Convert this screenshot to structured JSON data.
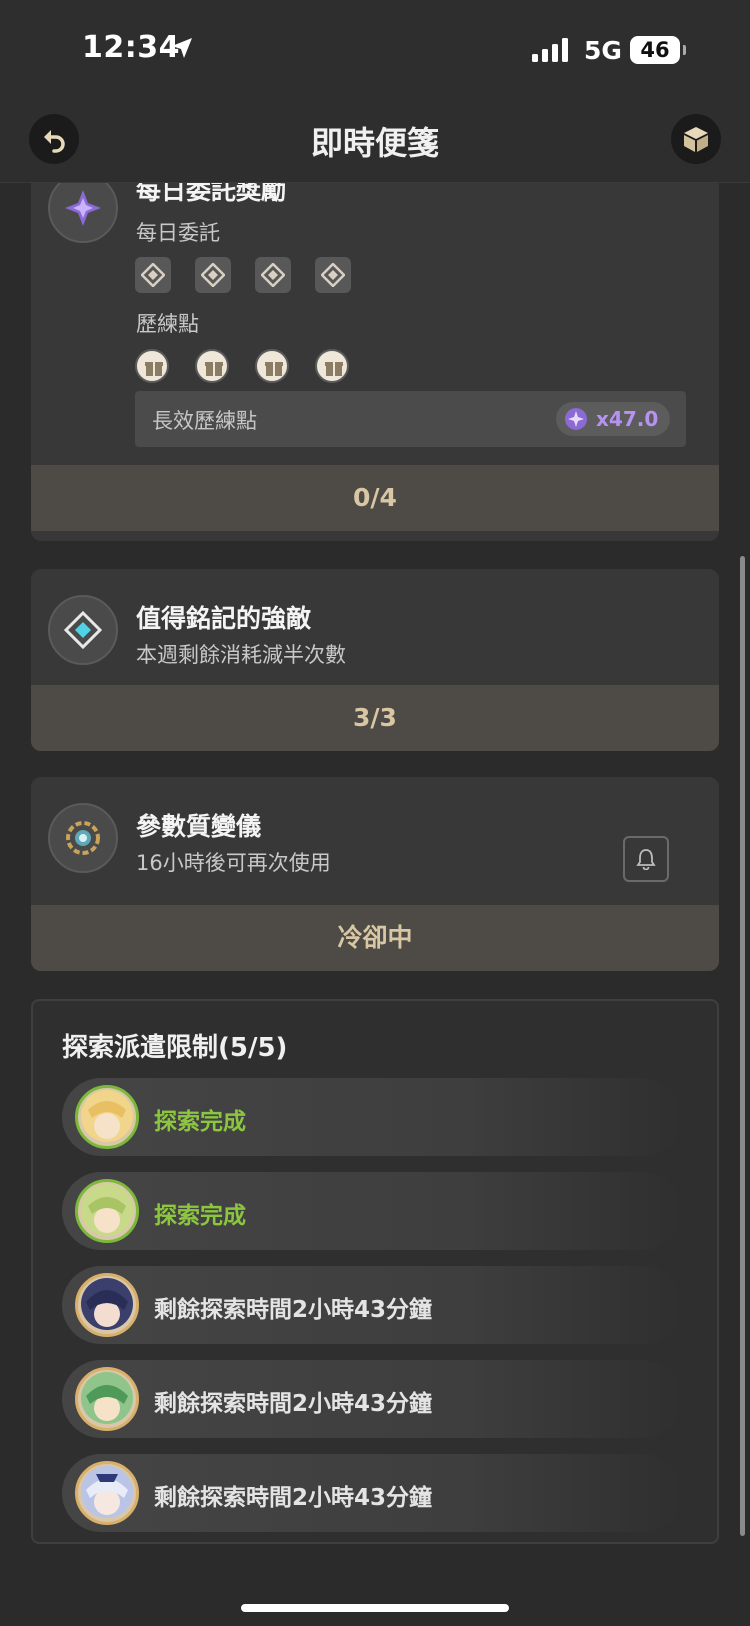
{
  "status": {
    "time": "12:34",
    "network": "5G",
    "battery": "46"
  },
  "header": {
    "title": "即時便箋"
  },
  "daily": {
    "title": "每日委託獎勵",
    "commissions_label": "每日委託",
    "training_label": "歷練點",
    "longterm_label": "長效歷練點",
    "longterm_value": "x47.0",
    "progress": "0/4"
  },
  "boss": {
    "title": "值得銘記的強敵",
    "subtitle": "本週剩餘消耗減半次數",
    "progress": "3/3"
  },
  "transformer": {
    "title": "參數質變儀",
    "subtitle": "16小時後可再次使用",
    "status": "冷卻中"
  },
  "expeditions": {
    "title": "探索派遣限制(5/5)",
    "items": [
      {
        "text": "探索完成",
        "done": true
      },
      {
        "text": "探索完成",
        "done": true
      },
      {
        "text": "剩餘探索時間2小時43分鐘",
        "done": false
      },
      {
        "text": "剩餘探索時間2小時43分鐘",
        "done": false
      },
      {
        "text": "剩餘探索時間2小時43分鐘",
        "done": false
      }
    ]
  },
  "colors": {
    "accent_gold": "#d9c7a4",
    "done_green": "#8cc63f",
    "purple": "#b693f0"
  }
}
